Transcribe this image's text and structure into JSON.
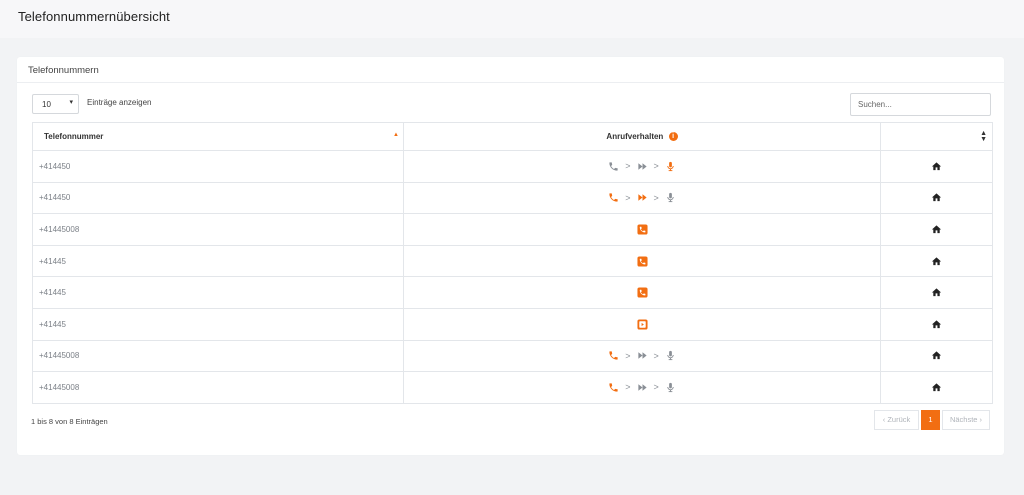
{
  "page": {
    "title": "Telefonnummernübersicht"
  },
  "card": {
    "title": "Telefonnummern"
  },
  "length": {
    "value": "10",
    "label": "Einträge anzeigen"
  },
  "search": {
    "placeholder": "Suchen..."
  },
  "table": {
    "headers": {
      "number": "Telefonnummer",
      "behavior": "Anrufverhalten",
      "behavior_info": "i"
    },
    "rows": [
      {
        "number": "+414450",
        "behavior": "flow-voicemail"
      },
      {
        "number": "+414450",
        "behavior": "flow-forward"
      },
      {
        "number": "+41445008",
        "behavior": "phone"
      },
      {
        "number": "+41445",
        "behavior": "phone"
      },
      {
        "number": "+41445",
        "behavior": "phone"
      },
      {
        "number": "+41445",
        "behavior": "play"
      },
      {
        "number": "+41445008",
        "behavior": "flow-phone"
      },
      {
        "number": "+41445008",
        "behavior": "flow-phone"
      }
    ]
  },
  "footer": {
    "info": "1 bis 8 von 8 Einträgen"
  },
  "pagination": {
    "prev": "‹ Zurück",
    "page": "1",
    "next": "Nächste ›"
  },
  "colors": {
    "accent": "#f26e12",
    "gray_icon": "#8a8f96"
  },
  "icons": {
    "phone": "phone-icon",
    "forward": "fast-forward-icon",
    "mic": "microphone-icon",
    "home": "home-icon",
    "play": "play-square-icon",
    "phone_square": "phone-square-icon"
  }
}
